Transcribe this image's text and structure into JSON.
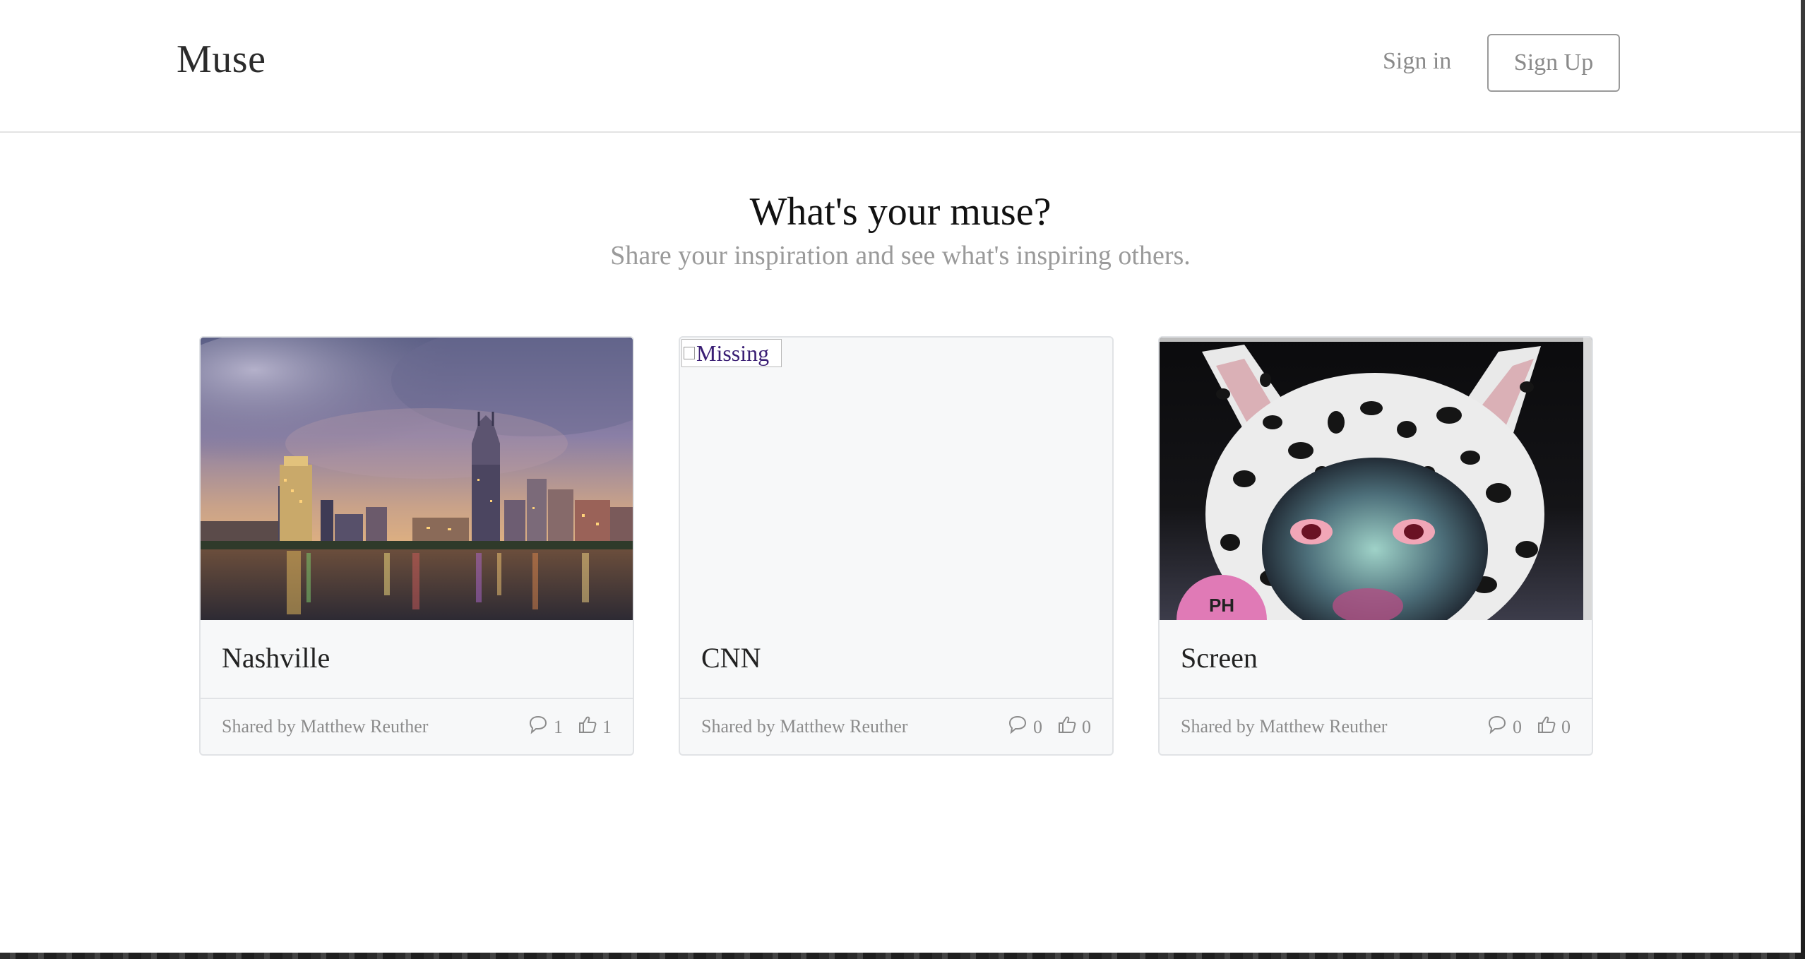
{
  "header": {
    "brand": "Muse",
    "sign_in": "Sign in",
    "sign_up": "Sign Up"
  },
  "hero": {
    "title": "What's your muse?",
    "subtitle": "Share your inspiration and see what's inspiring others."
  },
  "cards": [
    {
      "title": "Nashville",
      "shared_by": "Shared by Matthew Reuther",
      "comments": "1",
      "likes": "1",
      "image": "city-skyline-photo"
    },
    {
      "title": "CNN",
      "shared_by": "Shared by Matthew Reuther",
      "comments": "0",
      "likes": "0",
      "image_alt": "Missing"
    },
    {
      "title": "Screen",
      "shared_by": "Shared by Matthew Reuther",
      "comments": "0",
      "likes": "0",
      "image": "album-art-leopard-creature",
      "badge": "PH"
    }
  ],
  "icons": {
    "comment": "comment-icon",
    "like": "thumbs-up-icon"
  },
  "colors": {
    "muted_text": "#8c8c8c",
    "card_bg": "#f7f8f9",
    "border": "#e1e3e6",
    "link_purple": "#3a1e74"
  }
}
